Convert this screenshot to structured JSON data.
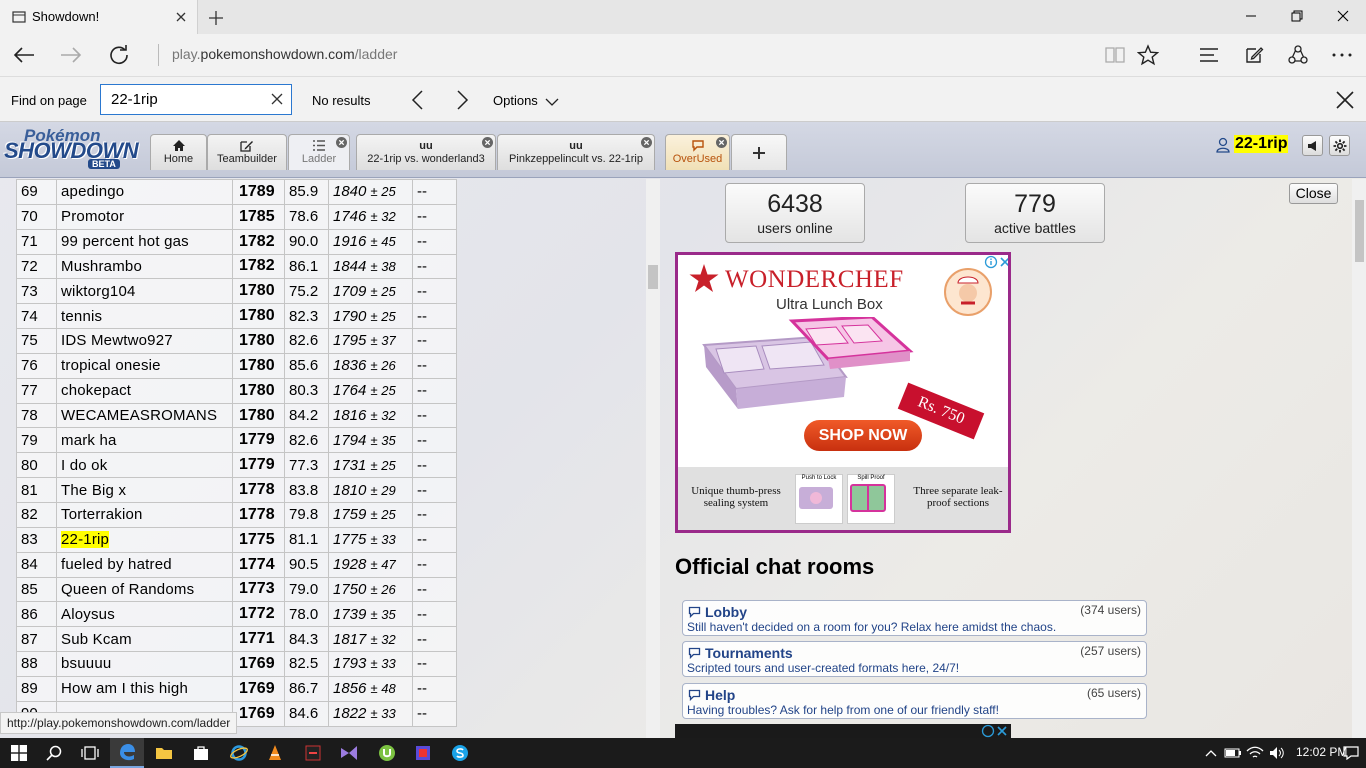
{
  "browser": {
    "tab_title": "Showdown!",
    "url_prefix": "play.",
    "url_host": "pokemonshowdown.com",
    "url_path": "/ladder"
  },
  "find": {
    "label": "Find on page",
    "query": "22-1rip",
    "result": "No results",
    "options_label": "Options"
  },
  "ps": {
    "logo_top": "Pokémon",
    "logo_main": "SHOWDOWN",
    "logo_badge": "BETA",
    "tabs": {
      "home": "Home",
      "teambuilder": "Teambuilder",
      "ladder": "Ladder",
      "battle1_format": "uu",
      "battle1_players": "22-1rip vs. wonderland3",
      "battle2_format": "uu",
      "battle2_players": "Pinkzeppelincult vs. 22-1rip",
      "overused": "OverUsed"
    },
    "username": "22-1rip"
  },
  "ladder": {
    "rows": [
      {
        "rank": "69",
        "name": "apedingo",
        "elo": "1789",
        "gxe": "85.9",
        "glicko": "1840",
        "dev": "± 25",
        "coil": "--"
      },
      {
        "rank": "70",
        "name": "Promotor",
        "elo": "1785",
        "gxe": "78.6",
        "glicko": "1746",
        "dev": "± 32",
        "coil": "--"
      },
      {
        "rank": "71",
        "name": "99 percent hot gas",
        "elo": "1782",
        "gxe": "90.0",
        "glicko": "1916",
        "dev": "± 45",
        "coil": "--"
      },
      {
        "rank": "72",
        "name": "Mushrambo",
        "elo": "1782",
        "gxe": "86.1",
        "glicko": "1844",
        "dev": "± 38",
        "coil": "--"
      },
      {
        "rank": "73",
        "name": "wiktorg104",
        "elo": "1780",
        "gxe": "75.2",
        "glicko": "1709",
        "dev": "± 25",
        "coil": "--"
      },
      {
        "rank": "74",
        "name": "tennis",
        "elo": "1780",
        "gxe": "82.3",
        "glicko": "1790",
        "dev": "± 25",
        "coil": "--"
      },
      {
        "rank": "75",
        "name": "IDS Mewtwo927",
        "elo": "1780",
        "gxe": "82.6",
        "glicko": "1795",
        "dev": "± 37",
        "coil": "--"
      },
      {
        "rank": "76",
        "name": "tropical onesie",
        "elo": "1780",
        "gxe": "85.6",
        "glicko": "1836",
        "dev": "± 26",
        "coil": "--"
      },
      {
        "rank": "77",
        "name": "chokepact",
        "elo": "1780",
        "gxe": "80.3",
        "glicko": "1764",
        "dev": "± 25",
        "coil": "--"
      },
      {
        "rank": "78",
        "name": "WECAMEASROMANS",
        "elo": "1780",
        "gxe": "84.2",
        "glicko": "1816",
        "dev": "± 32",
        "coil": "--"
      },
      {
        "rank": "79",
        "name": "mark ha",
        "elo": "1779",
        "gxe": "82.6",
        "glicko": "1794",
        "dev": "± 35",
        "coil": "--"
      },
      {
        "rank": "80",
        "name": "I do ok",
        "elo": "1779",
        "gxe": "77.3",
        "glicko": "1731",
        "dev": "± 25",
        "coil": "--"
      },
      {
        "rank": "81",
        "name": "The Big x",
        "elo": "1778",
        "gxe": "83.8",
        "glicko": "1810",
        "dev": "± 29",
        "coil": "--"
      },
      {
        "rank": "82",
        "name": "Torterrakion",
        "elo": "1778",
        "gxe": "79.8",
        "glicko": "1759",
        "dev": "± 25",
        "coil": "--"
      },
      {
        "rank": "83",
        "name": "22-1rip",
        "elo": "1775",
        "gxe": "81.1",
        "glicko": "1775",
        "dev": "± 33",
        "coil": "--",
        "highlight": true
      },
      {
        "rank": "84",
        "name": "fueled by hatred",
        "elo": "1774",
        "gxe": "90.5",
        "glicko": "1928",
        "dev": "± 47",
        "coil": "--"
      },
      {
        "rank": "85",
        "name": "Queen of Randoms",
        "elo": "1773",
        "gxe": "79.0",
        "glicko": "1750",
        "dev": "± 26",
        "coil": "--"
      },
      {
        "rank": "86",
        "name": "Aloysus",
        "elo": "1772",
        "gxe": "78.0",
        "glicko": "1739",
        "dev": "± 35",
        "coil": "--"
      },
      {
        "rank": "87",
        "name": "Sub Kcam",
        "elo": "1771",
        "gxe": "84.3",
        "glicko": "1817",
        "dev": "± 32",
        "coil": "--"
      },
      {
        "rank": "88",
        "name": "bsuuuu",
        "elo": "1769",
        "gxe": "82.5",
        "glicko": "1793",
        "dev": "± 33",
        "coil": "--"
      },
      {
        "rank": "89",
        "name": "How am I this high",
        "elo": "1769",
        "gxe": "86.7",
        "glicko": "1856",
        "dev": "± 48",
        "coil": "--"
      },
      {
        "rank": "90",
        "name": "",
        "elo": "1769",
        "gxe": "84.6",
        "glicko": "1822",
        "dev": "± 33",
        "coil": "--"
      }
    ]
  },
  "status": {
    "users_count": "6438",
    "users_label": "users online",
    "battles_count": "779",
    "battles_label": "active battles",
    "close_label": "Close"
  },
  "ad": {
    "brand": "WONDERCHEF",
    "product": "Ultra Lunch Box",
    "price": "Rs. 750",
    "cta": "SHOP NOW",
    "feature_left": "Unique thumb-press sealing system",
    "push_label": "Push to Lock",
    "spill_label": "Spill Proof",
    "feature_right": "Three separate leak-proof sections"
  },
  "rooms": {
    "title": "Official chat rooms",
    "list": [
      {
        "name": "Lobby",
        "users": "(374 users)",
        "desc": "Still haven't decided on a room for you? Relax here amidst the chaos."
      },
      {
        "name": "Tournaments",
        "users": "(257 users)",
        "desc": "Scripted tours and user-created formats here, 24/7!"
      },
      {
        "name": "Help",
        "users": "(65 users)",
        "desc": "Having troubles? Ask for help from one of our friendly staff!"
      }
    ]
  },
  "status_bar_url": "http://play.pokemonshowdown.com/ladder",
  "taskbar": {
    "time": "12:02 PM"
  }
}
